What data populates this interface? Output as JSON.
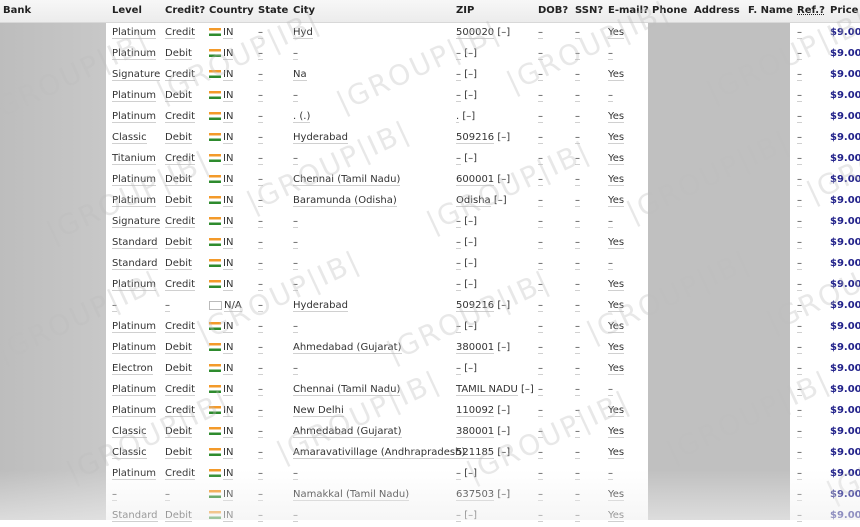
{
  "header": {
    "bank": "Bank",
    "level": "Level",
    "credit": "Credit?",
    "country": "Country",
    "state": "State",
    "city": "City",
    "zip": "ZIP",
    "dob": "DOB?",
    "ssn": "SSN?",
    "email": "E-mail?",
    "phone": "Phone",
    "address": "Address",
    "fname": "F. Name",
    "ref": "Ref.?",
    "price": "Price"
  },
  "watermark": "|GROUP|IB|",
  "rows": [
    {
      "level": "Platinum",
      "credit": "Credit",
      "country": "IN",
      "state": "–",
      "city": "Hyd",
      "zip": "500020",
      "dob": "–",
      "ssn": "–",
      "email": "Yes",
      "ref": "–",
      "price": "$9.00"
    },
    {
      "level": "Platinum",
      "credit": "Debit",
      "country": "IN",
      "state": "–",
      "city": "–",
      "zip": "–",
      "dob": "–",
      "ssn": "–",
      "email": "–",
      "ref": "–",
      "price": "$9.00"
    },
    {
      "level": "Signature",
      "credit": "Credit",
      "country": "IN",
      "state": "–",
      "city": "Na",
      "zip": "–",
      "dob": "–",
      "ssn": "–",
      "email": "Yes",
      "ref": "–",
      "price": "$9.00"
    },
    {
      "level": "Platinum",
      "credit": "Debit",
      "country": "IN",
      "state": "–",
      "city": "–",
      "zip": "–",
      "dob": "–",
      "ssn": "–",
      "email": "–",
      "ref": "–",
      "price": "$9.00"
    },
    {
      "level": "Platinum",
      "credit": "Credit",
      "country": "IN",
      "state": "–",
      "city": ". (.)",
      "zip": ".",
      "dob": "–",
      "ssn": "–",
      "email": "Yes",
      "ref": "–",
      "price": "$9.00"
    },
    {
      "level": "Classic",
      "credit": "Debit",
      "country": "IN",
      "state": "–",
      "city": "Hyderabad",
      "zip": "509216",
      "dob": "–",
      "ssn": "–",
      "email": "Yes",
      "ref": "–",
      "price": "$9.00"
    },
    {
      "level": "Titanium",
      "credit": "Credit",
      "country": "IN",
      "state": "–",
      "city": "–",
      "zip": "–",
      "dob": "–",
      "ssn": "–",
      "email": "Yes",
      "ref": "–",
      "price": "$9.00"
    },
    {
      "level": "Platinum",
      "credit": "Debit",
      "country": "IN",
      "state": "–",
      "city": "Chennai (Tamil Nadu)",
      "zip": "600001",
      "dob": "–",
      "ssn": "–",
      "email": "Yes",
      "ref": "–",
      "price": "$9.00"
    },
    {
      "level": "Platinum",
      "credit": "Debit",
      "country": "IN",
      "state": "–",
      "city": "Baramunda (Odisha)",
      "zip": "Odisha",
      "dob": "–",
      "ssn": "–",
      "email": "Yes",
      "ref": "–",
      "price": "$9.00"
    },
    {
      "level": "Signature",
      "credit": "Credit",
      "country": "IN",
      "state": "–",
      "city": "–",
      "zip": "–",
      "dob": "–",
      "ssn": "–",
      "email": "–",
      "ref": "–",
      "price": "$9.00"
    },
    {
      "level": "Standard",
      "credit": "Debit",
      "country": "IN",
      "state": "–",
      "city": "–",
      "zip": "–",
      "dob": "–",
      "ssn": "–",
      "email": "Yes",
      "ref": "–",
      "price": "$9.00"
    },
    {
      "level": "Standard",
      "credit": "Debit",
      "country": "IN",
      "state": "–",
      "city": "–",
      "zip": "–",
      "dob": "–",
      "ssn": "–",
      "email": "–",
      "ref": "–",
      "price": "$9.00"
    },
    {
      "level": "Platinum",
      "credit": "Credit",
      "country": "IN",
      "state": "–",
      "city": "–",
      "zip": "–",
      "dob": "–",
      "ssn": "–",
      "email": "Yes",
      "ref": "–",
      "price": "$9.00"
    },
    {
      "level": "–",
      "credit": "–",
      "country": "N/A",
      "state": "–",
      "city": "Hyderabad",
      "zip": "509216",
      "dob": "–",
      "ssn": "–",
      "email": "Yes",
      "ref": "–",
      "price": "$9.00"
    },
    {
      "level": "Platinum",
      "credit": "Credit",
      "country": "IN",
      "state": "–",
      "city": "–",
      "zip": "–",
      "dob": "–",
      "ssn": "–",
      "email": "Yes",
      "ref": "–",
      "price": "$9.00"
    },
    {
      "level": "Platinum",
      "credit": "Debit",
      "country": "IN",
      "state": "–",
      "city": "Ahmedabad (Gujarat)",
      "zip": "380001",
      "dob": "–",
      "ssn": "–",
      "email": "Yes",
      "ref": "–",
      "price": "$9.00"
    },
    {
      "level": "Electron",
      "credit": "Debit",
      "country": "IN",
      "state": "–",
      "city": "–",
      "zip": "–",
      "dob": "–",
      "ssn": "–",
      "email": "Yes",
      "ref": "–",
      "price": "$9.00"
    },
    {
      "level": "Platinum",
      "credit": "Credit",
      "country": "IN",
      "state": "–",
      "city": "Chennai (Tamil Nadu)",
      "zip": "TAMIL NADU",
      "dob": "–",
      "ssn": "–",
      "email": "–",
      "ref": "–",
      "price": "$9.00"
    },
    {
      "level": "Platinum",
      "credit": "Credit",
      "country": "IN",
      "state": "–",
      "city": "New Delhi",
      "zip": "110092",
      "dob": "–",
      "ssn": "–",
      "email": "Yes",
      "ref": "–",
      "price": "$9.00"
    },
    {
      "level": "Classic",
      "credit": "Debit",
      "country": "IN",
      "state": "–",
      "city": "Ahmedabad (Gujarat)",
      "zip": "380001",
      "dob": "–",
      "ssn": "–",
      "email": "Yes",
      "ref": "–",
      "price": "$9.00"
    },
    {
      "level": "Classic",
      "credit": "Debit",
      "country": "IN",
      "state": "–",
      "city": "Amaravativillage (Andhrapradesh)",
      "zip": "521185",
      "dob": "–",
      "ssn": "–",
      "email": "Yes",
      "ref": "–",
      "price": "$9.00"
    },
    {
      "level": "Platinum",
      "credit": "Credit",
      "country": "IN",
      "state": "–",
      "city": "–",
      "zip": "–",
      "dob": "–",
      "ssn": "–",
      "email": "–",
      "ref": "–",
      "price": "$9.00"
    },
    {
      "level": "–",
      "credit": "–",
      "country": "IN",
      "state": "–",
      "city": "Namakkal (Tamil Nadu)",
      "zip": "637503",
      "dob": "–",
      "ssn": "–",
      "email": "Yes",
      "ref": "–",
      "price": "$9.00"
    },
    {
      "level": "Standard",
      "credit": "Debit",
      "country": "IN",
      "state": "–",
      "city": "–",
      "zip": "–",
      "dob": "–",
      "ssn": "–",
      "email": "Yes",
      "ref": "–",
      "price": "$9.00"
    }
  ],
  "zip_suffix": "[–]"
}
